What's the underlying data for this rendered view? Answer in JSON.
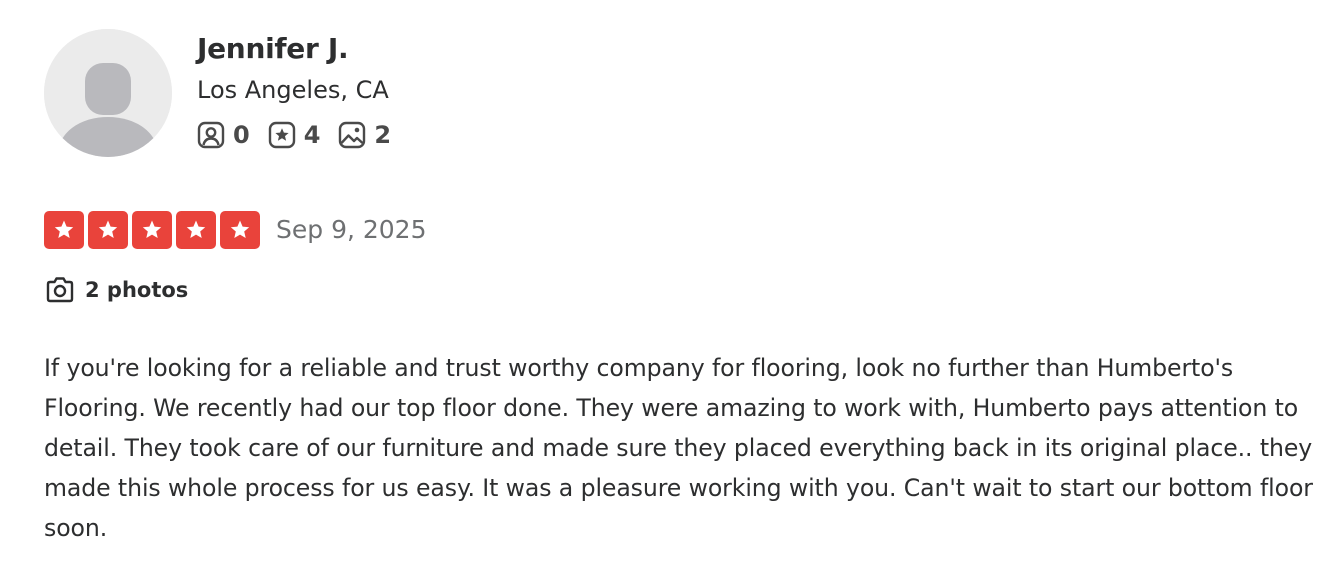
{
  "user": {
    "name": "Jennifer J.",
    "location": "Los Angeles, CA",
    "stats": {
      "friends": "0",
      "reviews": "4",
      "photos": "2"
    }
  },
  "review": {
    "rating": 5,
    "rating_max": 5,
    "date": "Sep 9, 2025",
    "photos_label": "2 photos",
    "text": "If you're looking for a reliable and trust worthy company for flooring, look no further than Humberto's Flooring. We recently had our top floor done. They were amazing to work with, Humberto pays attention to detail. They took care of our furniture and made sure they placed everything back in its original place.. they made this whole process for us easy. It was a pleasure working with you. Can't wait to start our bottom floor soon."
  },
  "icons": {
    "friends": "friends-icon",
    "reviews": "star-review-icon",
    "photos": "photo-icon",
    "camera": "camera-icon",
    "avatar": "default-avatar-icon"
  },
  "colors": {
    "star_fill": "#e9433b",
    "text": "#2d2e2f",
    "muted": "#6e7072"
  }
}
